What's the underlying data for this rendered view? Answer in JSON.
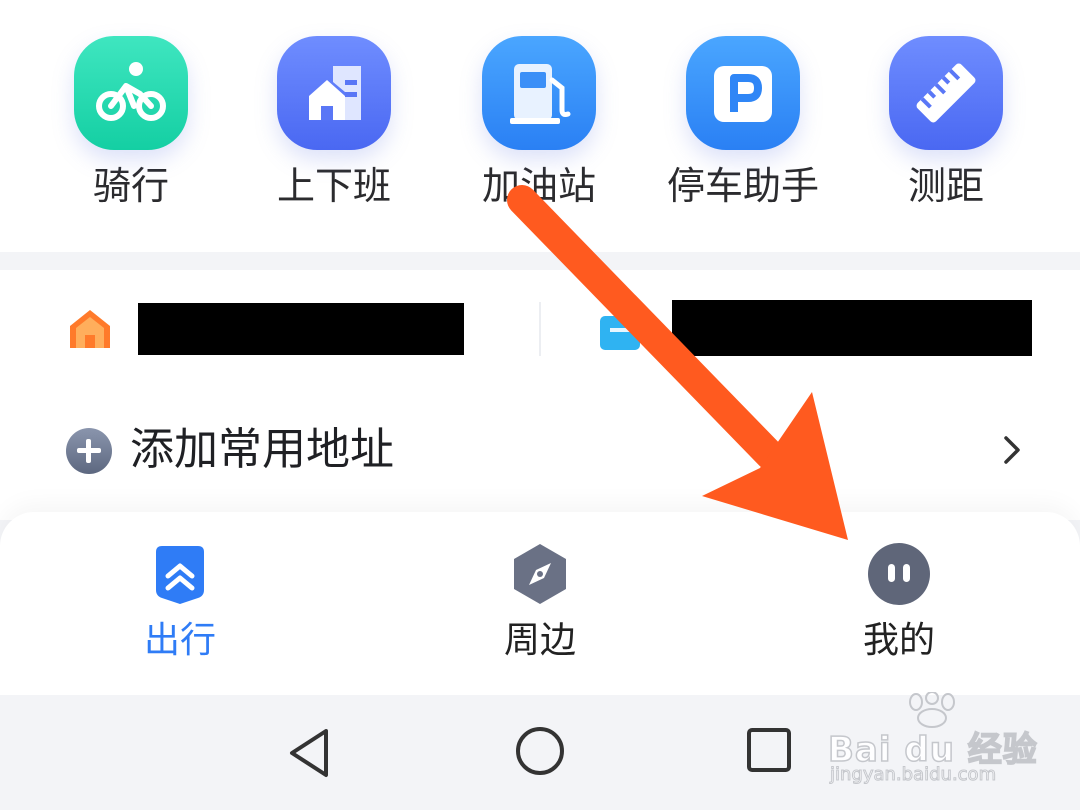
{
  "quick_actions": [
    {
      "label": "骑行",
      "icon": "bike-icon",
      "color_top": "#3fe6c0",
      "color_bottom": "#14cfa3"
    },
    {
      "label": "上下班",
      "icon": "commute-building-icon",
      "color_top": "#6f8dff",
      "color_bottom": "#4a68f2"
    },
    {
      "label": "加油站",
      "icon": "gas-pump-icon",
      "color_top": "#4aa6ff",
      "color_bottom": "#2a80f4"
    },
    {
      "label": "停车助手",
      "icon": "parking-icon",
      "color_top": "#4aa6ff",
      "color_bottom": "#2a80f4"
    },
    {
      "label": "测距",
      "icon": "ruler-icon",
      "color_top": "#6f8dff",
      "color_bottom": "#4a68f2"
    }
  ],
  "favorites": {
    "home_icon": "home-icon",
    "company_icon": "company-icon",
    "add_label": "添加常用地址",
    "add_icon": "plus-circle-icon",
    "chevron_icon": "chevron-right-icon"
  },
  "tabs": [
    {
      "label": "出行",
      "icon": "travel-icon",
      "active": true,
      "color": "#2f7cf6"
    },
    {
      "label": "周边",
      "icon": "compass-icon",
      "active": false,
      "color": "#222222"
    },
    {
      "label": "我的",
      "icon": "profile-icon",
      "active": false,
      "color": "#222222"
    }
  ],
  "system_nav": {
    "back_icon": "back-triangle-icon",
    "home_icon": "home-circle-icon",
    "recents_icon": "recents-square-icon"
  },
  "annotation": {
    "arrow_color": "#ff5a1f",
    "arrow_icon": "orange-arrow-icon"
  },
  "watermark": {
    "brand": "Bai du 经验",
    "url": "jingyan.baidu.com"
  }
}
